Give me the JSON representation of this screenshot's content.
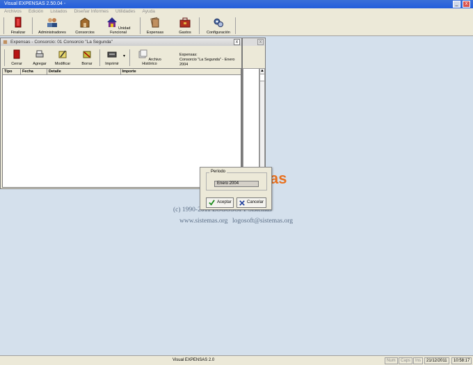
{
  "app": {
    "title": "Visual EXPENSAS 2.50.04 -",
    "window_buttons": [
      "_",
      "x"
    ]
  },
  "menu": [
    "Archivos",
    "Edición",
    "Listados",
    "Diseñar Informes",
    "Utilidades",
    "Ayuda"
  ],
  "toolbar": [
    {
      "label": "Finalizar",
      "icon": "exit-door-icon",
      "color": "#b81414"
    },
    {
      "label": "Administradores",
      "icon": "users-icon",
      "color": "#5577aa"
    },
    {
      "label": "Consorcios",
      "icon": "building-icon",
      "color": "#a06a2c"
    },
    {
      "label": "Unidad Funcional",
      "icon": "house-icon",
      "color": "#7a2a8a"
    },
    {
      "label": "Expensas",
      "icon": "papers-icon",
      "color": "#a07040"
    },
    {
      "label": "Gastos",
      "icon": "briefcase-icon",
      "color": "#b03020"
    },
    {
      "label": "Configuración",
      "icon": "gears-icon",
      "color": "#4a6aa0"
    }
  ],
  "expensas_window": {
    "title": "Expensas - Consorcio: 01 Consorcio \"La Segunda\"",
    "close": "x",
    "toolbar": [
      {
        "label": "Cerrar",
        "icon": "door-icon",
        "color": "#b81414"
      },
      {
        "label": "Agregar",
        "icon": "printer-add-icon",
        "color": "#606060"
      },
      {
        "label": "Modificar",
        "icon": "edit-icon",
        "color": "#9a8a20"
      },
      {
        "label": "Borrar",
        "icon": "delete-icon",
        "color": "#8a8a20"
      },
      {
        "label": "Imprimir",
        "icon": "printer-icon",
        "color": "#505050"
      },
      {
        "label": "Archivo Histórico",
        "icon": "archive-icon",
        "color": "#a0a0a0"
      }
    ],
    "dropdown_arrow": "▾",
    "info_title": "Expensas:",
    "info_value": "Consorcio \"La Segunda\" - Enero 2004",
    "columns": [
      "Tipo",
      "Fecha",
      "Detalle",
      "Importe"
    ]
  },
  "second_window": {
    "close": "x"
  },
  "watermark": {
    "logo": "as",
    "copyright": "(c) 1990-2011 LOGOSOFT Sistemas",
    "website": "www.sistemas.org",
    "email": "logosoft@sistemas.org"
  },
  "dialog": {
    "group_label": "Período",
    "value": "Enero 2004",
    "accept_label": "Aceptar",
    "cancel_label": "Cancelar"
  },
  "status": {
    "text": "Visual EXPENSAS 2.0",
    "num": "Num",
    "caps": "Caps",
    "ins": "Ins",
    "date": "21/12/2011",
    "time": "10:58:17"
  }
}
